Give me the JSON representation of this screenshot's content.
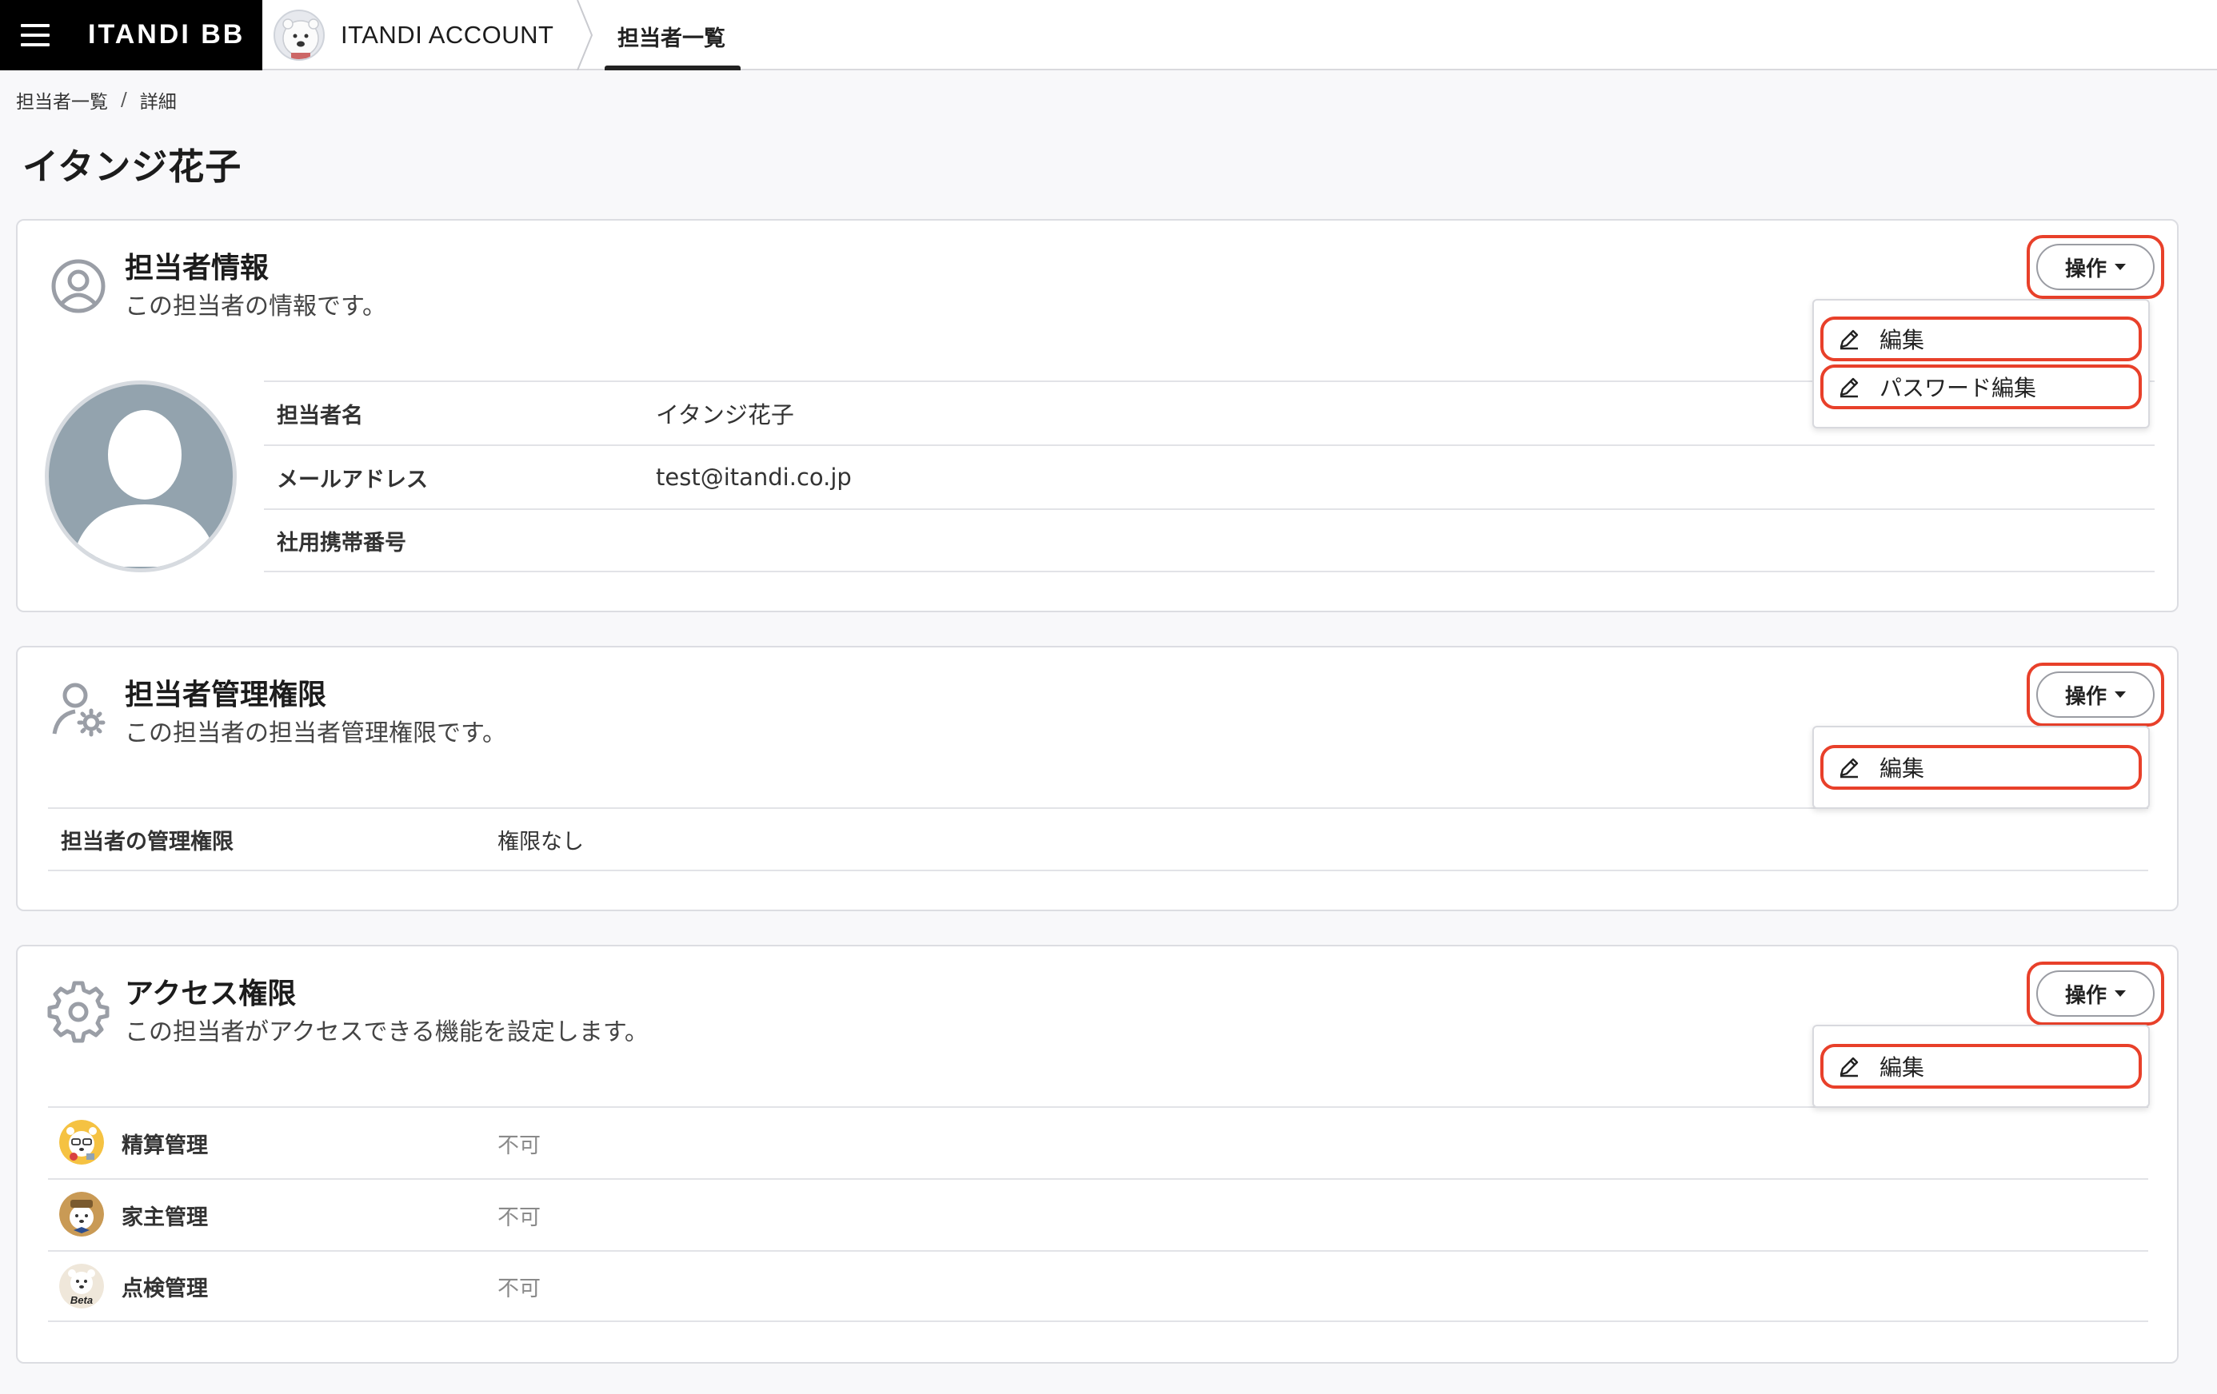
{
  "header": {
    "brand": "ITANDI BB",
    "account": "ITANDI ACCOUNT",
    "nav_tab": "担当者一覧"
  },
  "breadcrumb": {
    "items": [
      "担当者一覧",
      "詳細"
    ],
    "separator": "/"
  },
  "page_title": "イタンジ花子",
  "colors": {
    "highlight": "#e8402a",
    "avatar": "#93a3ae"
  },
  "sections": {
    "info": {
      "title": "担当者情報",
      "description": "この担当者の情報です。",
      "icon": "user-circle-icon",
      "op_button": "操作",
      "menu": [
        "編集",
        "パスワード編集"
      ],
      "rows": [
        {
          "label": "担当者名",
          "value": "イタンジ花子"
        },
        {
          "label": "メールアドレス",
          "value": "test@itandi.co.jp"
        },
        {
          "label": "社用携帯番号",
          "value": ""
        }
      ]
    },
    "admin": {
      "title": "担当者管理権限",
      "description": "この担当者の担当者管理権限です。",
      "icon": "user-gear-icon",
      "op_button": "操作",
      "menu": [
        "編集"
      ],
      "rows": [
        {
          "label": "担当者の管理権限",
          "value": "権限なし"
        }
      ]
    },
    "access": {
      "title": "アクセス権限",
      "description": "この担当者がアクセスできる機能を設定します。",
      "icon": "gear-icon",
      "op_button": "操作",
      "menu": [
        "編集"
      ],
      "rows": [
        {
          "label": "精算管理",
          "value": "不可",
          "icon": "bear-glasses-icon"
        },
        {
          "label": "家主管理",
          "value": "不可",
          "icon": "bear-hat-icon"
        },
        {
          "label": "点検管理",
          "value": "不可",
          "icon": "bear-beta-icon",
          "badge": "Beta"
        }
      ]
    }
  }
}
